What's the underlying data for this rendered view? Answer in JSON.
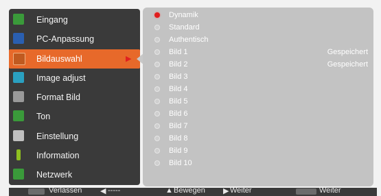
{
  "sidebar": {
    "items": [
      {
        "label": "Eingang",
        "icon": "input-icon",
        "color": "#3a9a3a"
      },
      {
        "label": "PC-Anpassung",
        "icon": "monitor-icon",
        "color": "#2a5fb0"
      },
      {
        "label": "Bildauswahl",
        "icon": "image-select-icon",
        "color": "#c05a20",
        "active": true
      },
      {
        "label": "Image adjust",
        "icon": "image-adjust-icon",
        "color": "#2aa0c0"
      },
      {
        "label": "Format Bild",
        "icon": "screen-format-icon",
        "color": "#9a9a9a"
      },
      {
        "label": "Ton",
        "icon": "speaker-icon",
        "color": "#3a9a3a"
      },
      {
        "label": "Einstellung",
        "icon": "tools-icon",
        "color": "#c0c0c0"
      },
      {
        "label": "Information",
        "icon": "info-icon",
        "color": "#8fc020"
      },
      {
        "label": "Netzwerk",
        "icon": "network-icon",
        "color": "#3a9a3a"
      }
    ]
  },
  "panel": {
    "options": [
      {
        "label": "Dynamik",
        "selected": true,
        "status": ""
      },
      {
        "label": "Standard",
        "selected": false,
        "status": ""
      },
      {
        "label": "Authentisch",
        "selected": false,
        "status": ""
      },
      {
        "label": "Bild 1",
        "selected": false,
        "status": "Gespeichert"
      },
      {
        "label": "Bild 2",
        "selected": false,
        "status": "Gespeichert"
      },
      {
        "label": "Bild 3",
        "selected": false,
        "status": ""
      },
      {
        "label": "Bild 4",
        "selected": false,
        "status": ""
      },
      {
        "label": "Bild 5",
        "selected": false,
        "status": ""
      },
      {
        "label": "Bild 6",
        "selected": false,
        "status": ""
      },
      {
        "label": "Bild 7",
        "selected": false,
        "status": ""
      },
      {
        "label": "Bild 8",
        "selected": false,
        "status": ""
      },
      {
        "label": "Bild 9",
        "selected": false,
        "status": ""
      },
      {
        "label": "Bild 10",
        "selected": false,
        "status": ""
      }
    ]
  },
  "footer": {
    "exit_label": "Verlassen",
    "dash_label": "-----",
    "move_label": "Bewegen",
    "next_label": "Weiter",
    "next2_label": "Weiter"
  }
}
